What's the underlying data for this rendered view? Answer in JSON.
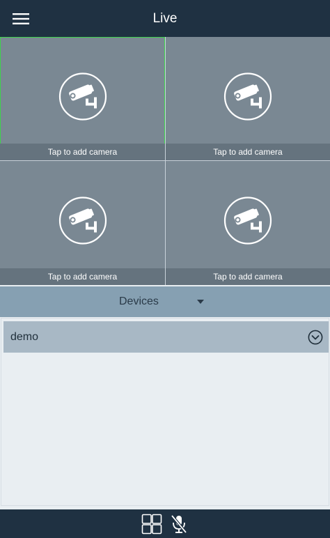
{
  "header": {
    "title": "Live",
    "menu_icon": "hamburger-menu-icon",
    "background": "#1f3142"
  },
  "grid": {
    "cells": [
      {
        "caption": "Tap to add camera",
        "icon": "cctv-camera-icon",
        "selected": true
      },
      {
        "caption": "Tap to add camera",
        "icon": "cctv-camera-icon",
        "selected": false
      },
      {
        "caption": "Tap to add camera",
        "icon": "cctv-camera-icon",
        "selected": false
      },
      {
        "caption": "Tap to add camera",
        "icon": "cctv-camera-icon",
        "selected": false
      }
    ],
    "selected_color": "#3ed24c"
  },
  "devices": {
    "label": "Devices",
    "dropdown_icon": "caret-down-icon",
    "items": [
      {
        "name": "demo",
        "icon": "chevron-down-circle-icon"
      }
    ]
  },
  "bottom_bar": {
    "layout_icon": "grid-layout-icon",
    "mic_icon": "microphone-muted-icon"
  }
}
